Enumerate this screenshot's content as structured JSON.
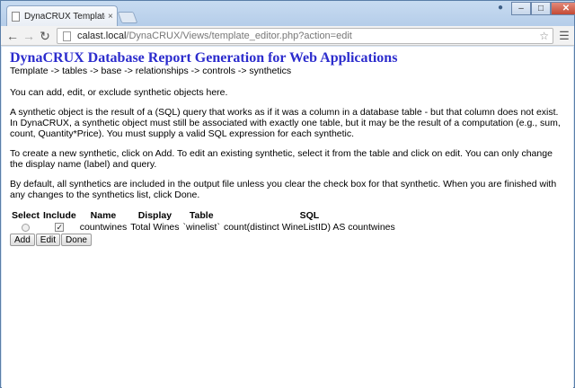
{
  "browser": {
    "tab_title": "DynaCRUX Template Edito",
    "tab_close": "×",
    "url_host": "calast.local",
    "url_path": "/DynaCRUX/Views/template_editor.php?action=edit",
    "window_controls": {
      "minimize": "–",
      "maximize": "□",
      "close": "✕"
    },
    "icons": [
      "page-icon",
      "back-icon",
      "forward-icon",
      "reload-icon",
      "star-icon",
      "menu-icon",
      "person-icon"
    ]
  },
  "page": {
    "heading": "DynaCRUX Database Report Generation for Web Applications",
    "breadcrumb": "Template -> tables -> base -> relationships -> controls -> synthetics",
    "intro": "You can add, edit, or exclude synthetic objects here.",
    "para1": "A synthetic object is the result of a (SQL) query that works as if it was a column in a database table - but that column does not exist. In DynaCRUX, a synthetic object must still be associated with exactly one table, but it may be the result of a computation (e.g., sum, count, Quantity*Price). You must supply a valid SQL expression for each synthetic.",
    "para2": "To create a new synthetic, click on Add. To edit an existing synthetic, select it from the table and click on edit. You can only change the display name (label) and query.",
    "para3": "By default, all synthetics are included in the output file unless you clear the check box for that synthetic. When you are finished with any changes to the synthetics list, click Done."
  },
  "table": {
    "headers": [
      "Select",
      "Include",
      "Name",
      "Display",
      "Table",
      "SQL"
    ],
    "rows": [
      {
        "select": false,
        "include": true,
        "name": "countwines",
        "display": "Total Wines",
        "table": "`winelist`",
        "sql": "count(distinct WineListID) AS countwines"
      }
    ]
  },
  "buttons": {
    "add": "Add",
    "edit": "Edit",
    "done": "Done"
  }
}
